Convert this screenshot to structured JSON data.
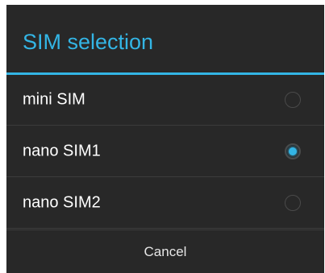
{
  "dialog": {
    "title": "SIM selection",
    "options": [
      {
        "label": "mini SIM",
        "selected": false
      },
      {
        "label": "nano SIM1",
        "selected": true
      },
      {
        "label": "nano SIM2",
        "selected": false
      }
    ],
    "cancel_label": "Cancel"
  },
  "colors": {
    "accent": "#33b5e5",
    "background": "#282828",
    "divider": "#3c3c3c",
    "text": "#ffffff"
  }
}
